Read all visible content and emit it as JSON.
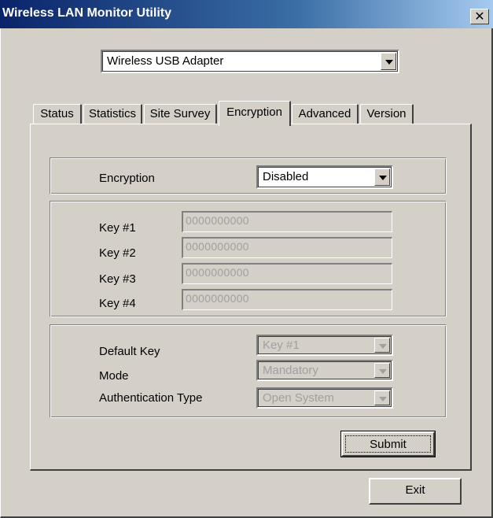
{
  "window": {
    "title": "Wireless LAN Monitor Utility",
    "close_glyph": "✕"
  },
  "adapter_select": {
    "value": "Wireless USB Adapter"
  },
  "tabs": [
    {
      "label": "Status"
    },
    {
      "label": "Statistics"
    },
    {
      "label": "Site Survey"
    },
    {
      "label": "Encryption"
    },
    {
      "label": "Advanced"
    },
    {
      "label": "Version"
    }
  ],
  "active_tab": "Encryption",
  "encryption": {
    "label": "Encryption",
    "value": "Disabled"
  },
  "keys": [
    {
      "label": "Key #1",
      "value": "0000000000"
    },
    {
      "label": "Key #2",
      "value": "0000000000"
    },
    {
      "label": "Key #3",
      "value": "0000000000"
    },
    {
      "label": "Key #4",
      "value": "0000000000"
    }
  ],
  "settings": {
    "default_key": {
      "label": "Default Key",
      "value": "Key #1"
    },
    "mode": {
      "label": "Mode",
      "value": "Mandatory"
    },
    "auth_type": {
      "label": "Authentication Type",
      "value": "Open System"
    }
  },
  "buttons": {
    "submit": "Submit",
    "exit": "Exit"
  },
  "icons": {
    "dropdown": "chevron-down-icon",
    "close": "close-icon"
  }
}
